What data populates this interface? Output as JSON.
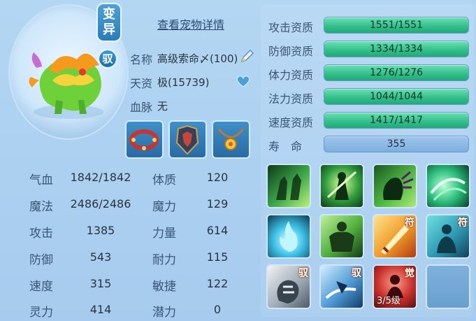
{
  "header": {
    "transform_badge": [
      "变",
      "异"
    ],
    "control_badge": "驭",
    "detail_link": "查看宠物详情"
  },
  "pet": {
    "name_label": "名称",
    "name_value": "高级索命〆(100)",
    "aptitude_label": "天资",
    "aptitude_value": "极(15739)",
    "bloodline_label": "血脉",
    "bloodline_value": "无"
  },
  "equipment": [
    "bracelet",
    "armor",
    "necklace"
  ],
  "attributes": [
    {
      "label": "攻击资质",
      "value": "1551/1551",
      "fill": 1.0
    },
    {
      "label": "防御资质",
      "value": "1334/1334",
      "fill": 1.0
    },
    {
      "label": "体力资质",
      "value": "1276/1276",
      "fill": 1.0
    },
    {
      "label": "法力资质",
      "value": "1044/1044",
      "fill": 1.0
    },
    {
      "label": "速度资质",
      "value": "1417/1417",
      "fill": 1.0
    }
  ],
  "lifespan": {
    "label": "寿　命",
    "value": "355"
  },
  "stats": [
    {
      "k1": "气血",
      "v1": "1842/1842",
      "k2": "体质",
      "v2": "120"
    },
    {
      "k1": "魔法",
      "v1": "2486/2486",
      "k2": "魔力",
      "v2": "129"
    },
    {
      "k1": "攻击",
      "v1": "1385",
      "k2": "力量",
      "v2": "614"
    },
    {
      "k1": "防御",
      "v1": "543",
      "k2": "耐力",
      "v2": "115"
    },
    {
      "k1": "速度",
      "v1": "315",
      "k2": "敏捷",
      "v2": "122"
    },
    {
      "k1": "灵力",
      "v1": "414",
      "k2": "潜力",
      "v2": "0"
    }
  ],
  "skills": {
    "row3_tags": [
      "驭",
      "驭",
      "觉"
    ],
    "row2_tags": [
      "符",
      "符"
    ],
    "awaken_level": "3/5级"
  },
  "colors": {
    "bar_green": "#34c08c",
    "bar_blue": "#7eaedf",
    "panel": "#a9cdee"
  }
}
